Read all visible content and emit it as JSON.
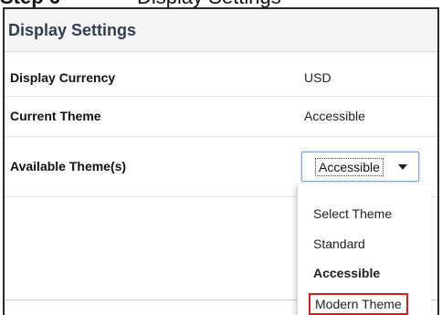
{
  "page_fragment": {
    "bold_text": "Step 6",
    "plain_text": "Display Settings"
  },
  "panel": {
    "title": "Display Settings"
  },
  "rows": {
    "currency": {
      "label": "Display Currency",
      "value": "USD"
    },
    "theme": {
      "label": "Current Theme",
      "value": "Accessible"
    },
    "available": {
      "label": "Available Theme(s)"
    }
  },
  "theme_select": {
    "selected": "Accessible",
    "options": [
      "Select Theme",
      "Standard",
      "Accessible",
      "Modern Theme"
    ],
    "highlighted_option": "Modern Theme"
  },
  "colors": {
    "highlight_border": "#e0191e",
    "select_focus": "#7aa7e0",
    "header_bg": "#f5f5f5"
  },
  "icons": {
    "dropdown_caret": "chevron-down-icon"
  }
}
